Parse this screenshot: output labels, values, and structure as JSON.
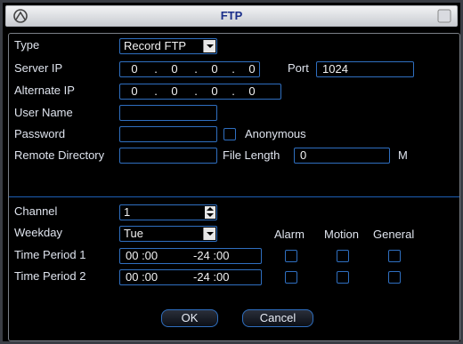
{
  "window": {
    "title": "FTP"
  },
  "type": {
    "label": "Type",
    "value": "Record FTP"
  },
  "server_ip": {
    "label": "Server IP",
    "octets": [
      "0",
      "0",
      "0",
      "0"
    ]
  },
  "port": {
    "label": "Port",
    "value": "1024"
  },
  "alternate_ip": {
    "label": "Alternate IP",
    "octets": [
      "0",
      "0",
      "0",
      "0"
    ]
  },
  "user_name": {
    "label": "User Name",
    "value": ""
  },
  "password": {
    "label": "Password",
    "value": ""
  },
  "anonymous": {
    "label": "Anonymous",
    "checked": false
  },
  "remote_directory": {
    "label": "Remote Directory",
    "value": ""
  },
  "file_length": {
    "label": "File Length",
    "value": "0",
    "unit": "M"
  },
  "channel": {
    "label": "Channel",
    "value": "1"
  },
  "weekday": {
    "label": "Weekday",
    "value": "Tue"
  },
  "columns": {
    "alarm": "Alarm",
    "motion": "Motion",
    "general": "General"
  },
  "time_periods": [
    {
      "label": "Time Period 1",
      "start": "00 :00",
      "end": "-24 :00",
      "alarm": false,
      "motion": false,
      "general": false
    },
    {
      "label": "Time Period 2",
      "start": "00 :00",
      "end": "-24 :00",
      "alarm": false,
      "motion": false,
      "general": false
    }
  ],
  "buttons": {
    "ok": "OK",
    "cancel": "Cancel"
  },
  "icons": {
    "logo": "dvr-logo-icon",
    "close": "close-icon"
  }
}
